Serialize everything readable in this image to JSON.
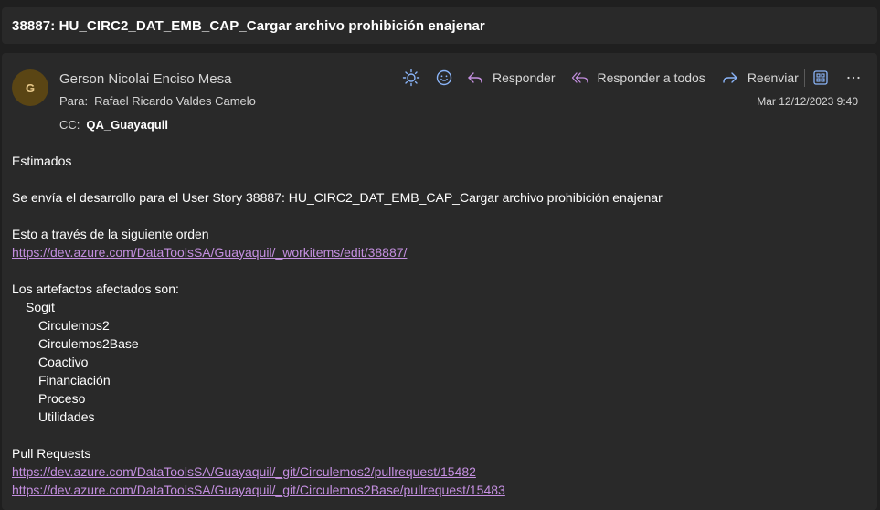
{
  "subject": "38887: HU_CIRC2_DAT_EMB_CAP_Cargar archivo prohibición enajenar",
  "message": {
    "avatar_initial": "G",
    "sender": "Gerson Nicolai Enciso Mesa",
    "to_label": "Para:",
    "to_value": "Rafael Ricardo Valdes Camelo",
    "cc_label": "CC:",
    "cc_value": "QA_Guayaquil",
    "date": "Mar 12/12/2023 9:40",
    "toolbar": {
      "reply": "Responder",
      "reply_all": "Responder a todos",
      "forward": "Reenviar",
      "icons": [
        "brightness-icon",
        "emoji-icon",
        "reply-icon",
        "reply-all-icon",
        "forward-icon",
        "apps-icon",
        "more-icon"
      ]
    }
  },
  "body": {
    "greeting": "Estimados",
    "intro": "Se envía el desarrollo para el User Story 38887: HU_CIRC2_DAT_EMB_CAP_Cargar archivo prohibición enajenar",
    "order_text": "Esto a través de la siguiente orden",
    "order_link": "https://dev.azure.com/DataToolsSA/Guayaquil/_workitems/edit/38887/",
    "artifacts_title": "Los artefactos afectados son:",
    "artifact_group": "Sogit",
    "artifacts": [
      "Circulemos2",
      "Circulemos2Base",
      "Coactivo",
      "Financiación",
      "Proceso",
      "Utilidades"
    ],
    "pr_title": "Pull Requests",
    "pr_links": [
      "https://dev.azure.com/DataToolsSA/Guayaquil/_git/Circulemos2/pullrequest/15482",
      "https://dev.azure.com/DataToolsSA/Guayaquil/_git/Circulemos2Base/pullrequest/15483"
    ]
  },
  "colors": {
    "background": "#1f1f1f",
    "panel": "#292929",
    "link": "#c48fe0",
    "icon_accent": "#8ab4f8",
    "reply_icon": "#c48fe0",
    "avatar_bg": "#5a4514"
  }
}
